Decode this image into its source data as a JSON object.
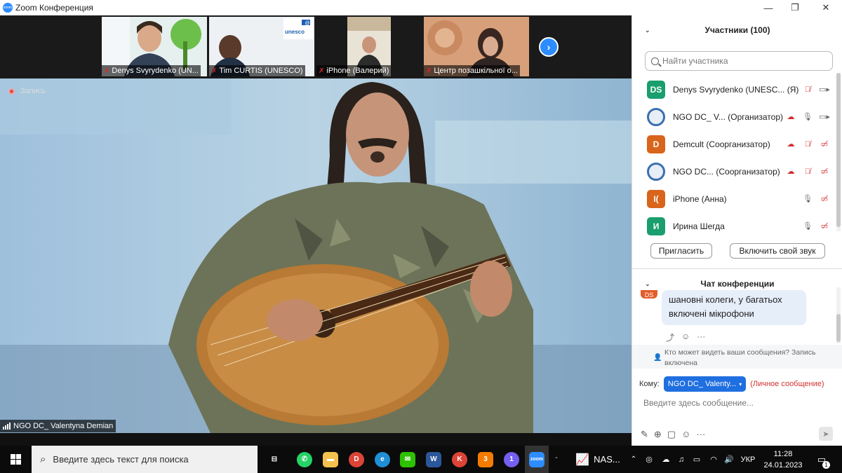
{
  "window": {
    "title": "Zoom Конференция",
    "controls": {
      "minimize": "—",
      "maximize": "❐",
      "close": "✕"
    }
  },
  "thumbnails": [
    {
      "label": "Denys Svyrydenko (UN..."
    },
    {
      "label": "Tim CURTIS (UNESCO)"
    },
    {
      "label": "iPhone (Валерий)"
    },
    {
      "label": "Центр позашкільної о..."
    }
  ],
  "thumb_art": {
    "unesco_text": "unesco",
    "at_sign": "@"
  },
  "next_arrow": "›",
  "main_video": {
    "recording_label": "Запись",
    "speaker_name": "NGO DC_ Valentyna Demian"
  },
  "participants_panel": {
    "title": "Участники (100)",
    "caret": "⌄",
    "search_placeholder": "Найти участника",
    "rows": [
      {
        "initials": "DS",
        "color": "#1a9e6e",
        "name": "Denys Svyrydenko (UNESC...",
        "suffix": "(Я)",
        "icons": [
          "mic-muted",
          "video"
        ]
      },
      {
        "initials": "",
        "color": "",
        "name": "NGO DC_ V...",
        "suffix": "(Организатор)",
        "icons": [
          "cloud-rec",
          "mic",
          "video"
        ]
      },
      {
        "initials": "D",
        "color": "#d9641b",
        "name": "Demcult",
        "suffix": "(Соорганизатор)",
        "icons": [
          "cloud-rec",
          "mic-muted",
          "video-off"
        ]
      },
      {
        "initials": "",
        "color": "",
        "name": "NGO DC...",
        "suffix": "(Соорганизатор)",
        "icons": [
          "cloud-rec",
          "mic-muted",
          "video-off"
        ]
      },
      {
        "initials": "I(",
        "color": "#d9641b",
        "name": "iPhone (Анна)",
        "suffix": "",
        "icons": [
          "mic",
          "video-off"
        ]
      },
      {
        "initials": "И",
        "color": "#1a9e6e",
        "name": "Ирина Шегда",
        "suffix": "",
        "icons": [
          "mic",
          "video-off"
        ]
      }
    ],
    "invite_button": "Пригласить",
    "unmute_button": "Включить свой звук"
  },
  "chat_panel": {
    "title": "Чат конференции",
    "caret": "⌄",
    "message_avatar": "DS",
    "message_text": "шановні колеги, у багатьох включені мікрофони",
    "reactions": [
      "⤴",
      "☺",
      "···"
    ],
    "notice": "Кто может видеть ваши сообщения? Запись включена",
    "to_label": "Кому:",
    "to_value": "NGO DC_ Valenty...",
    "to_private": "(Личное сообщение)",
    "input_placeholder": "Введите здесь сообщение...",
    "tools": [
      "✎",
      "⊕",
      "▢",
      "☺",
      "···"
    ],
    "send_icon": "➤"
  },
  "taskbar": {
    "search_placeholder": "Введите здесь текст для поиска",
    "apps": [
      {
        "name": "task-view",
        "label": "⊟",
        "color": "#0b0b0b"
      },
      {
        "name": "whatsapp",
        "label": "✆",
        "color": "#25d366"
      },
      {
        "name": "file-explorer",
        "label": "▬",
        "color": "#f2c14e"
      },
      {
        "name": "chrome-d",
        "label": "D",
        "color": "#db4437"
      },
      {
        "name": "edge",
        "label": "e",
        "color": "#1f8fd6"
      },
      {
        "name": "wechat",
        "label": "✉",
        "color": "#2dc100"
      },
      {
        "name": "word",
        "label": "W",
        "color": "#2b579a"
      },
      {
        "name": "chrome-k",
        "label": "K",
        "color": "#db4437"
      },
      {
        "name": "app-3",
        "label": "3",
        "color": "#f57c00"
      },
      {
        "name": "viber",
        "label": "1",
        "color": "#7360f2"
      },
      {
        "name": "zoom",
        "label": "zoom",
        "color": "#2d8cff"
      }
    ],
    "stock_label": "NAS...",
    "tray_lang": "УКР",
    "time": "11:28",
    "date": "24.01.2023",
    "notifications": "1"
  }
}
